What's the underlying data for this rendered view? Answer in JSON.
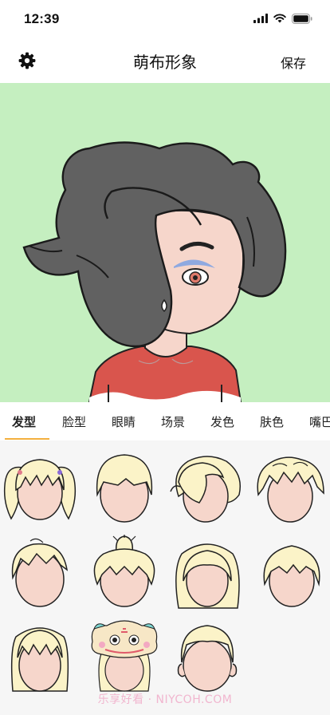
{
  "status_bar": {
    "time": "12:39"
  },
  "nav": {
    "title": "萌布形象",
    "save_label": "保存"
  },
  "tabs": [
    {
      "label": "发型",
      "active": true
    },
    {
      "label": "脸型"
    },
    {
      "label": "眼睛"
    },
    {
      "label": "场景"
    },
    {
      "label": "发色"
    },
    {
      "label": "肤色"
    },
    {
      "label": "嘴巴"
    }
  ],
  "colors": {
    "accent": "#f3b03e",
    "preview_bg": "#c5efc0",
    "hair_preview": "#616161",
    "skin": "#f6d6cb",
    "hair_option": "#fbf3c8",
    "shirt": "#d9554d"
  },
  "hair_options": [
    "hairstyle-pigtails",
    "hairstyle-bowl",
    "hairstyle-wavy-side",
    "hairstyle-messy-wavy",
    "hairstyle-tousled",
    "hairstyle-top-bun",
    "hairstyle-long-center",
    "hairstyle-short-bob",
    "hairstyle-straight-bangs",
    "hairstyle-lion-hat",
    "hairstyle-short-flat"
  ],
  "watermark": "乐享好看 · NIYCOH.COM"
}
